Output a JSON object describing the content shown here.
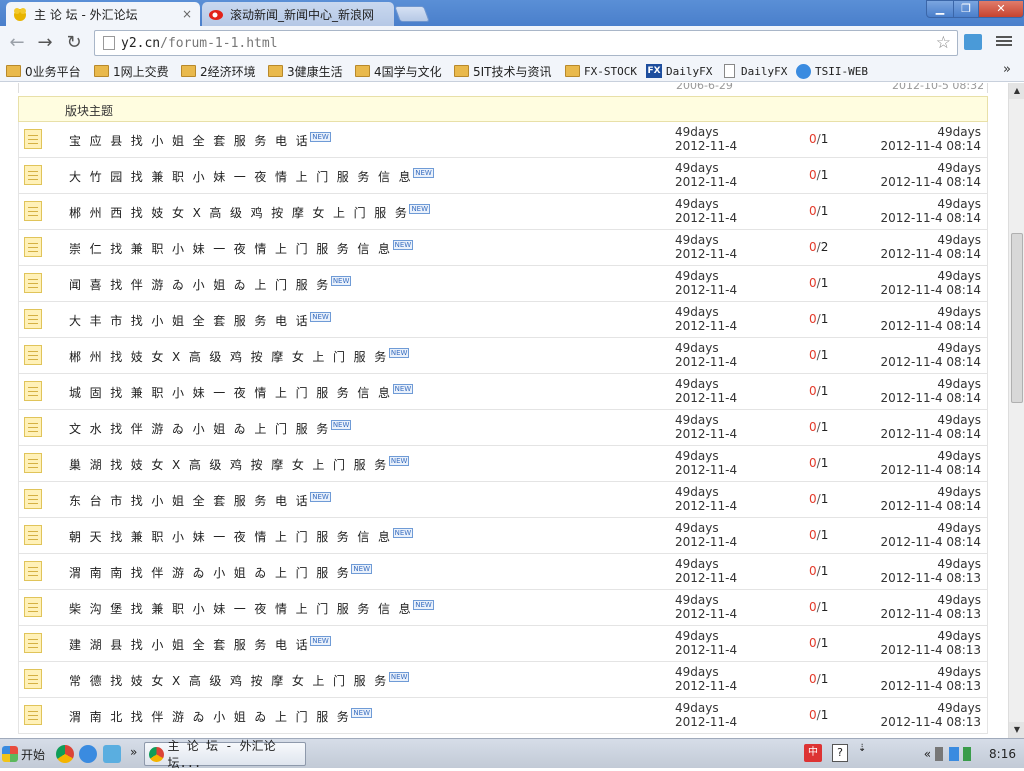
{
  "window": {
    "active_tab": {
      "title": "主 论 坛 - 外汇论坛",
      "close": "×"
    },
    "inactive_tab": {
      "title": "滚动新闻_新闻中心_新浪网"
    },
    "controls": {
      "min": "▁",
      "max": "❐",
      "close": "✕"
    }
  },
  "toolbar": {
    "back": "←",
    "forward": "→",
    "reload": "↻",
    "url_host": "y2.cn",
    "url_path": "/forum-1-1.html",
    "star": "☆"
  },
  "bookmarks": [
    {
      "label": "0业务平台"
    },
    {
      "label": "1网上交费"
    },
    {
      "label": "2经济环境"
    },
    {
      "label": "3健康生活"
    },
    {
      "label": "4国学与文化"
    },
    {
      "label": "5IT技术与资讯"
    },
    {
      "label": "FX-STOCK"
    },
    {
      "label": "DailyFX"
    },
    {
      "label": "DailyFX"
    },
    {
      "label": "TSII-WEB"
    }
  ],
  "bookmarks_more": "»",
  "prev_row": {
    "date1": "2006-6-29",
    "date2": "2012-10-5 08:32"
  },
  "section_header": "版块主题",
  "new_badge": "NEW",
  "threads": [
    {
      "title": "宝应县找小姐全套服务电话",
      "author": "49days",
      "date": "2012-11-4",
      "replies": "0",
      "views": "1",
      "last_user": "49days",
      "last_time": "2012-11-4 08:14"
    },
    {
      "title": "大竹园找兼职小妹一夜情上门服务信息",
      "author": "49days",
      "date": "2012-11-4",
      "replies": "0",
      "views": "1",
      "last_user": "49days",
      "last_time": "2012-11-4 08:14"
    },
    {
      "title": "郴州西找妓女X高级鸡按摩女上门服务",
      "author": "49days",
      "date": "2012-11-4",
      "replies": "0",
      "views": "1",
      "last_user": "49days",
      "last_time": "2012-11-4 08:14"
    },
    {
      "title": "崇仁找兼职小妹一夜情上门服务信息",
      "author": "49days",
      "date": "2012-11-4",
      "replies": "0",
      "views": "2",
      "last_user": "49days",
      "last_time": "2012-11-4 08:14"
    },
    {
      "title": "闻喜找伴游ゐ小姐ゐ上门服务",
      "author": "49days",
      "date": "2012-11-4",
      "replies": "0",
      "views": "1",
      "last_user": "49days",
      "last_time": "2012-11-4 08:14"
    },
    {
      "title": "大丰市找小姐全套服务电话",
      "author": "49days",
      "date": "2012-11-4",
      "replies": "0",
      "views": "1",
      "last_user": "49days",
      "last_time": "2012-11-4 08:14"
    },
    {
      "title": "郴州找妓女X高级鸡按摩女上门服务",
      "author": "49days",
      "date": "2012-11-4",
      "replies": "0",
      "views": "1",
      "last_user": "49days",
      "last_time": "2012-11-4 08:14"
    },
    {
      "title": "城固找兼职小妹一夜情上门服务信息",
      "author": "49days",
      "date": "2012-11-4",
      "replies": "0",
      "views": "1",
      "last_user": "49days",
      "last_time": "2012-11-4 08:14"
    },
    {
      "title": "文水找伴游ゐ小姐ゐ上门服务",
      "author": "49days",
      "date": "2012-11-4",
      "replies": "0",
      "views": "1",
      "last_user": "49days",
      "last_time": "2012-11-4 08:14"
    },
    {
      "title": "巢湖找妓女X高级鸡按摩女上门服务",
      "author": "49days",
      "date": "2012-11-4",
      "replies": "0",
      "views": "1",
      "last_user": "49days",
      "last_time": "2012-11-4 08:14"
    },
    {
      "title": "东台市找小姐全套服务电话",
      "author": "49days",
      "date": "2012-11-4",
      "replies": "0",
      "views": "1",
      "last_user": "49days",
      "last_time": "2012-11-4 08:14"
    },
    {
      "title": "朝天找兼职小妹一夜情上门服务信息",
      "author": "49days",
      "date": "2012-11-4",
      "replies": "0",
      "views": "1",
      "last_user": "49days",
      "last_time": "2012-11-4 08:14"
    },
    {
      "title": "渭南南找伴游ゐ小姐ゐ上门服务",
      "author": "49days",
      "date": "2012-11-4",
      "replies": "0",
      "views": "1",
      "last_user": "49days",
      "last_time": "2012-11-4 08:13"
    },
    {
      "title": "柴沟堡找兼职小妹一夜情上门服务信息",
      "author": "49days",
      "date": "2012-11-4",
      "replies": "0",
      "views": "1",
      "last_user": "49days",
      "last_time": "2012-11-4 08:13"
    },
    {
      "title": "建湖县找小姐全套服务电话",
      "author": "49days",
      "date": "2012-11-4",
      "replies": "0",
      "views": "1",
      "last_user": "49days",
      "last_time": "2012-11-4 08:13"
    },
    {
      "title": "常德找妓女X高级鸡按摩女上门服务",
      "author": "49days",
      "date": "2012-11-4",
      "replies": "0",
      "views": "1",
      "last_user": "49days",
      "last_time": "2012-11-4 08:13"
    },
    {
      "title": "渭南北找伴游ゐ小姐ゐ上门服务",
      "author": "49days",
      "date": "2012-11-4",
      "replies": "0",
      "views": "1",
      "last_user": "49days",
      "last_time": "2012-11-4 08:13"
    }
  ],
  "scrollbar": {
    "up": "▲",
    "down": "▼"
  },
  "taskbar": {
    "start": "开始",
    "more": "»",
    "chrome_task": "主 论 坛 - 外汇论坛...",
    "ime": "中",
    "help": "?",
    "tray_arrow": "«",
    "clock": "8:16"
  }
}
